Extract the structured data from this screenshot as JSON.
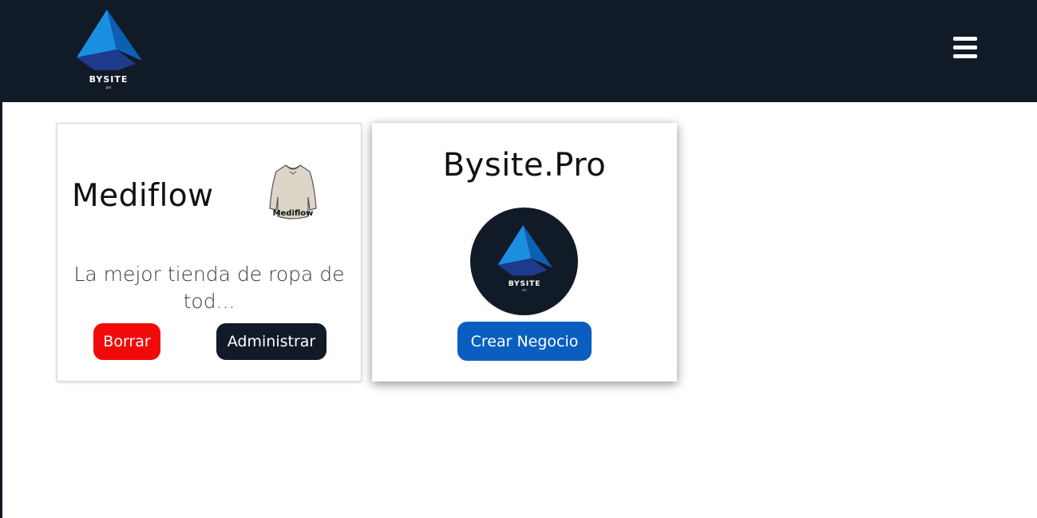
{
  "header": {
    "logo_text": "BYSITE",
    "logo_subtext": "pro",
    "menu_icon": "hamburger-menu-icon",
    "background_color": "#111a27"
  },
  "cards": [
    {
      "title": "Mediflow",
      "image_label": "Mediflow",
      "image_icon": "sweater-icon",
      "description": "La mejor tienda de ropa de tod...",
      "buttons": {
        "delete": "Borrar",
        "manage": "Administrar"
      }
    },
    {
      "title": "Bysite.Pro",
      "logo_text": "BYSITE",
      "logo_subtext": "pro",
      "button": "Crear Negocio"
    }
  ],
  "colors": {
    "delete": "#f20a0a",
    "manage": "#111a27",
    "create": "#0a5ec0",
    "logo_light_blue": "#1a8fe0",
    "logo_blue": "#0c5fb3",
    "logo_navy": "#1e3a8a"
  }
}
